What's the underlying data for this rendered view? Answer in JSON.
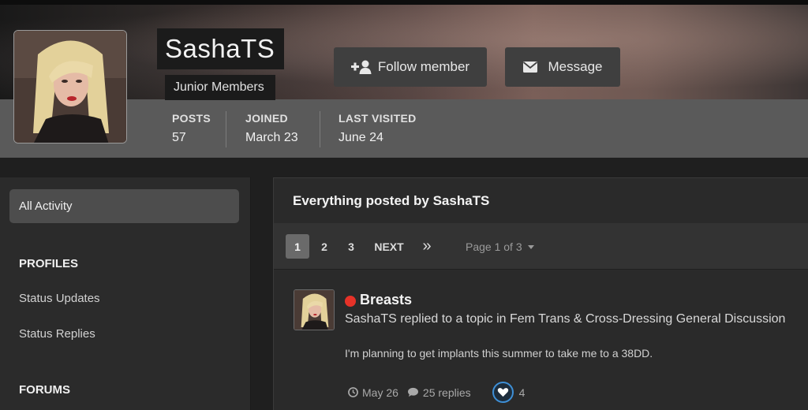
{
  "profile": {
    "name": "SashaTS",
    "group": "Junior Members",
    "follow_label": "Follow member",
    "message_label": "Message",
    "stats": [
      {
        "label": "POSTS",
        "value": "57"
      },
      {
        "label": "JOINED",
        "value": "March 23"
      },
      {
        "label": "LAST VISITED",
        "value": "June 24"
      }
    ]
  },
  "sidebar": {
    "active_item": "All Activity",
    "profiles_heading": "PROFILES",
    "profiles_items": [
      "Status Updates",
      "Status Replies"
    ],
    "forums_heading": "FORUMS"
  },
  "main": {
    "title": "Everything posted by SashaTS",
    "pagination": {
      "pages": [
        "1",
        "2",
        "3"
      ],
      "current": "1",
      "next_label": "NEXT",
      "last_label": "»",
      "page_of": "Page 1 of 3"
    },
    "post": {
      "title": "Breasts",
      "meta": "SashaTS replied to a topic in Fem Trans & Cross-Dressing General Discussion",
      "snippet": "I'm planning to get implants this summer to take me to a 38DD.",
      "date": "May 26",
      "replies": "25 replies",
      "reaction_count": "4"
    }
  },
  "colors": {
    "unread_dot": "#e63228",
    "reaction_ring": "#3e8fd6",
    "stats_bar": "#5a5a5a"
  },
  "icons": {
    "follow": "user-plus-icon",
    "message": "envelope-icon",
    "date": "clock-icon",
    "replies": "comment-icon",
    "reaction": "heart-icon",
    "dropdown": "caret-down-icon"
  }
}
